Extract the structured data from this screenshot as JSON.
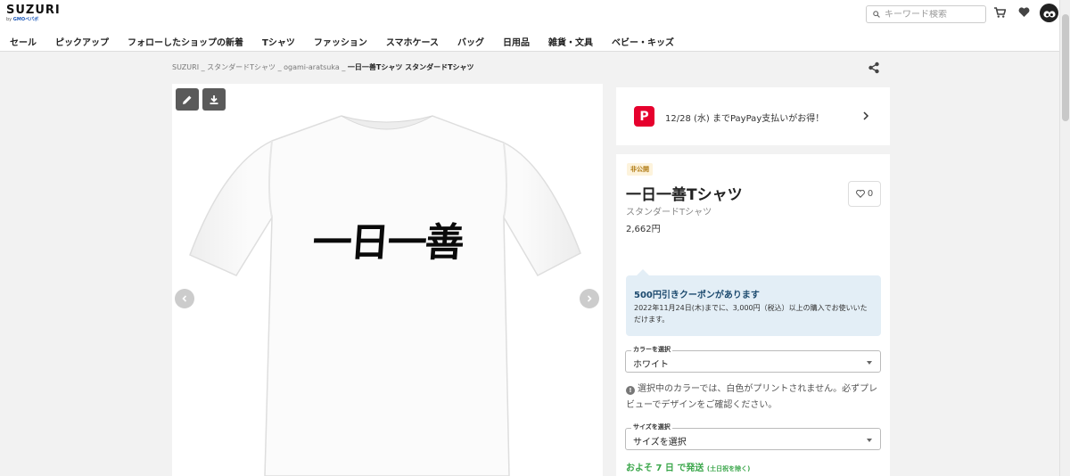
{
  "header": {
    "logo": "SUZURI",
    "logo_by": "by",
    "logo_company": "GMOペパボ",
    "search_placeholder": "キーワード検索",
    "icons": [
      "search-icon",
      "cart-icon",
      "heart-icon",
      "avatar"
    ]
  },
  "nav": {
    "items": [
      "セール",
      "ピックアップ",
      "フォローしたショップの新着",
      "Tシャツ",
      "ファッション",
      "スマホケース",
      "バッグ",
      "日用品",
      "雑貨・文具",
      "ベビー・キッズ"
    ]
  },
  "breadcrumb": {
    "items": [
      "SUZURI",
      "スタンダードTシャツ",
      "ogami-aratsuka"
    ],
    "separator": "_",
    "current": "一日一善Tシャツ スタンダードTシャツ"
  },
  "image_panel": {
    "print_text": "一日一善",
    "tool_icons": [
      "edit-icon",
      "download-icon"
    ]
  },
  "paypay": {
    "icon_letter": "P",
    "text": "12/28 (水) までPayPay支払いがお得！"
  },
  "product": {
    "badge": "非公開",
    "title": "一日一善Tシャツ",
    "type": "スタンダードTシャツ",
    "price": "2,662円",
    "like_count": "0"
  },
  "coupon": {
    "title": "500円引きクーポンがあります",
    "desc": "2022年11月24日(木)までに、3,000円（税込）以上の購入でお使いいただけます。"
  },
  "color_select": {
    "label": "カラーを選択",
    "value": "ホワイト"
  },
  "notice": {
    "icon": "!",
    "text": "選択中のカラーでは、白色がプリントされません。必ずプレビューでデザインをご確認ください。"
  },
  "size_select": {
    "label": "サイズを選択",
    "value": "サイズを選択"
  },
  "shipping": {
    "text": "およそ 7 日 で発送",
    "note": "(土日祝を除く)"
  },
  "colors": {
    "paypay": "#e6002d",
    "coupon_bg": "#e3eef6",
    "shipping": "#3aa64a"
  }
}
